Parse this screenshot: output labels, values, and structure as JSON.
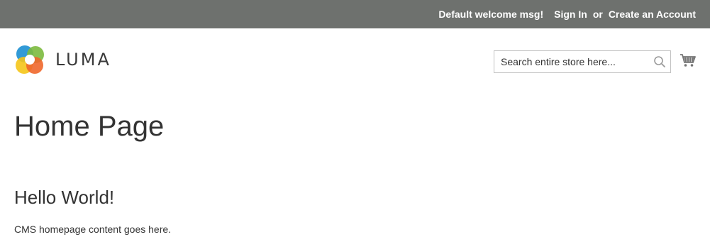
{
  "topbar": {
    "welcome": "Default welcome msg!",
    "sign_in": "Sign In",
    "or": "or",
    "create_account": "Create an Account",
    "background": "#6e716e"
  },
  "header": {
    "logo_text": "LUMA",
    "logo_icon": "luma-logo-icon",
    "search_placeholder": "Search entire store here...",
    "search_icon": "search-icon",
    "cart_icon": "cart-icon"
  },
  "main": {
    "page_title": "Home Page",
    "heading": "Hello World!",
    "text": "CMS homepage content goes here."
  }
}
